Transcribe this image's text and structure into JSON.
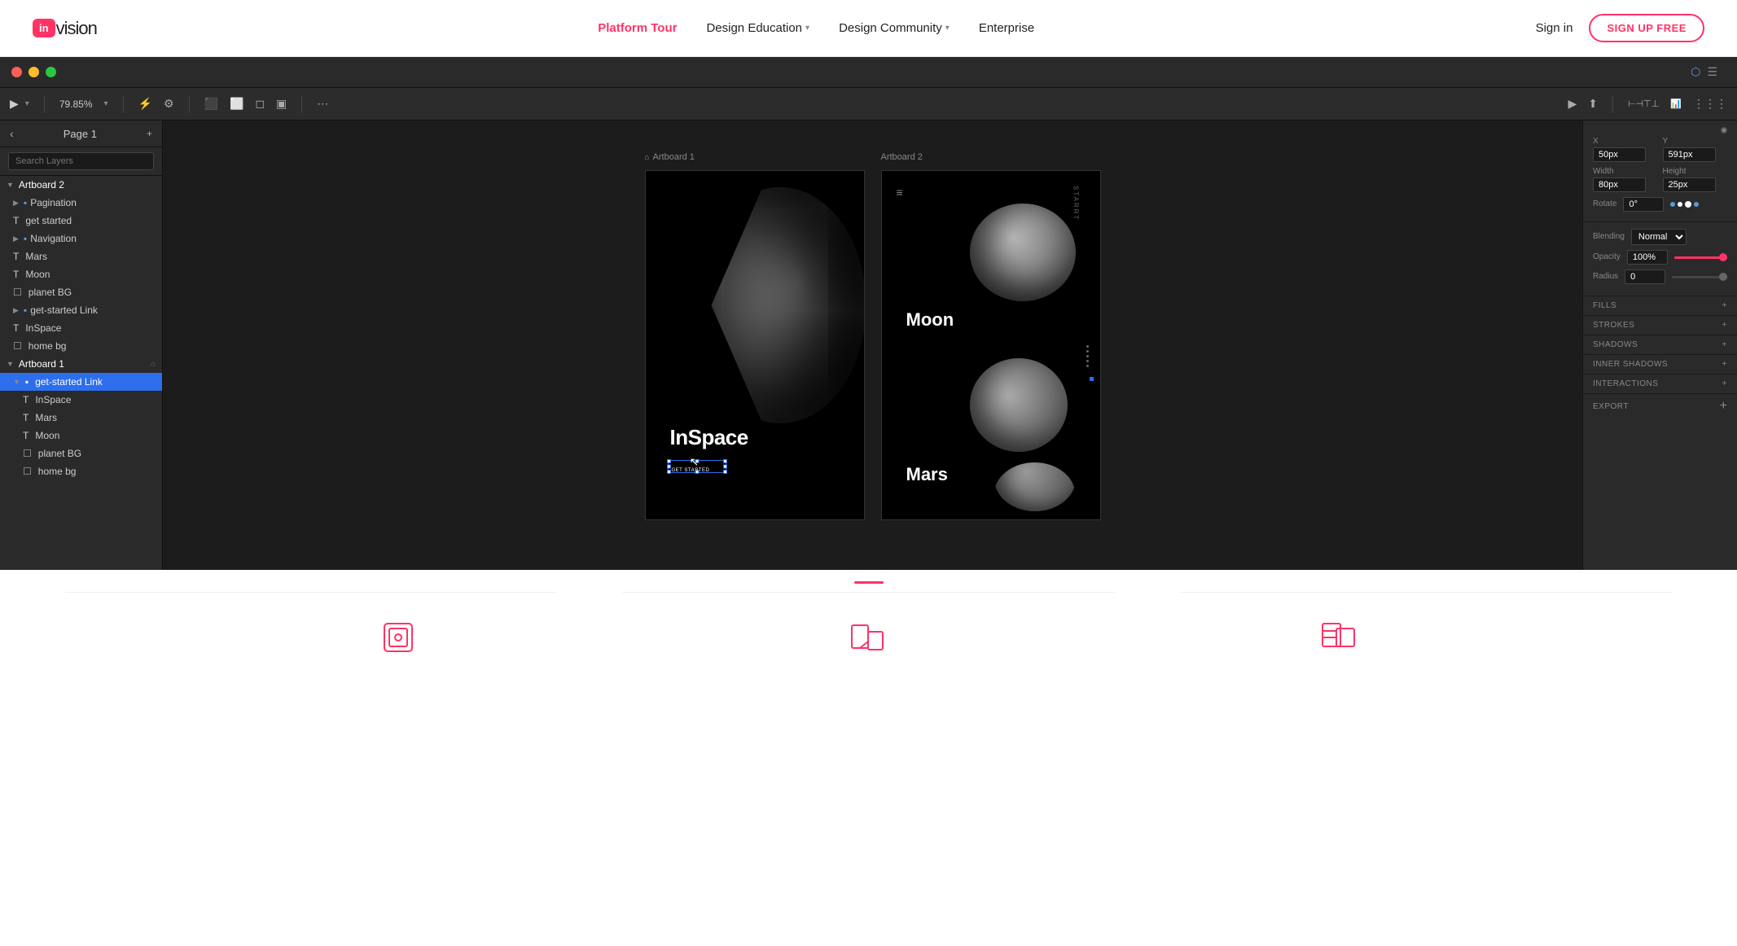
{
  "nav": {
    "logo_in": "in",
    "logo_vision": "vision",
    "links": [
      {
        "label": "Platform Tour",
        "active": true,
        "has_dropdown": false
      },
      {
        "label": "Design Education",
        "active": false,
        "has_dropdown": true
      },
      {
        "label": "Design Community",
        "active": false,
        "has_dropdown": true
      },
      {
        "label": "Enterprise",
        "active": false,
        "has_dropdown": false
      }
    ],
    "sign_in": "Sign in",
    "sign_up": "SIGN UP FREE"
  },
  "app": {
    "toolbar": {
      "zoom": "79.85%",
      "zoom_icon": "▾"
    },
    "sidebar": {
      "page_label": "Page 1",
      "search_placeholder": "Search Layers",
      "layers": [
        {
          "level": 0,
          "type": "group",
          "label": "Artboard 2",
          "expanded": true,
          "icon": "▼"
        },
        {
          "level": 1,
          "type": "folder",
          "label": "Pagination",
          "expanded": false,
          "icon": "▶"
        },
        {
          "level": 1,
          "type": "text",
          "label": "get started",
          "icon": "T"
        },
        {
          "level": 1,
          "type": "folder",
          "label": "Navigation",
          "expanded": false,
          "icon": "▶"
        },
        {
          "level": 1,
          "type": "text",
          "label": "Mars",
          "icon": "T"
        },
        {
          "level": 1,
          "type": "text",
          "label": "Moon",
          "icon": "T"
        },
        {
          "level": 1,
          "type": "image",
          "label": "planet BG",
          "icon": "☐"
        },
        {
          "level": 1,
          "type": "folder",
          "label": "get-started Link",
          "expanded": false,
          "icon": "▶"
        },
        {
          "level": 1,
          "type": "text",
          "label": "InSpace",
          "icon": "T"
        },
        {
          "level": 1,
          "type": "image",
          "label": "home bg",
          "icon": "☐"
        },
        {
          "level": 0,
          "type": "group",
          "label": "Artboard 1",
          "expanded": true,
          "icon": "▼"
        },
        {
          "level": 1,
          "type": "folder",
          "label": "get-started Link",
          "expanded": true,
          "icon": "▼",
          "selected": true
        },
        {
          "level": 2,
          "type": "text",
          "label": "InSpace",
          "icon": "T"
        },
        {
          "level": 2,
          "type": "text",
          "label": "Mars",
          "icon": "T"
        },
        {
          "level": 2,
          "type": "text",
          "label": "Moon",
          "icon": "T"
        },
        {
          "level": 2,
          "type": "image",
          "label": "planet BG",
          "icon": "☐"
        },
        {
          "level": 2,
          "type": "image",
          "label": "home bg",
          "icon": "☐"
        }
      ]
    },
    "artboard1": {
      "label": "Artboard 1",
      "inspace_text": "InSpace",
      "get_started_text": "GET STARTED"
    },
    "artboard2": {
      "label": "Artboard 2",
      "moon_label": "Moon",
      "mars_label": "Mars"
    },
    "right_panel": {
      "x_label": "X",
      "x_value": "50px",
      "y_label": "Y",
      "y_value": "591px",
      "width_label": "Width",
      "width_value": "80px",
      "height_label": "Height",
      "height_value": "25px",
      "rotate_label": "Rotate",
      "rotate_value": "0°",
      "blending_label": "Blending",
      "blending_value": "Normal",
      "opacity_label": "Opacity",
      "opacity_value": "100%",
      "radius_label": "Radius",
      "radius_value": "0",
      "fills_label": "FILLS",
      "strokes_label": "STROKES",
      "shadows_label": "SHADOWS",
      "inner_shadows_label": "INNER SHADOWS",
      "interactions_label": "INTERACTIONS",
      "export_label": "EXPORT"
    }
  },
  "bottom": {
    "feature1_icon": "layers",
    "feature2_icon": "prototype",
    "feature3_icon": "inspect"
  }
}
